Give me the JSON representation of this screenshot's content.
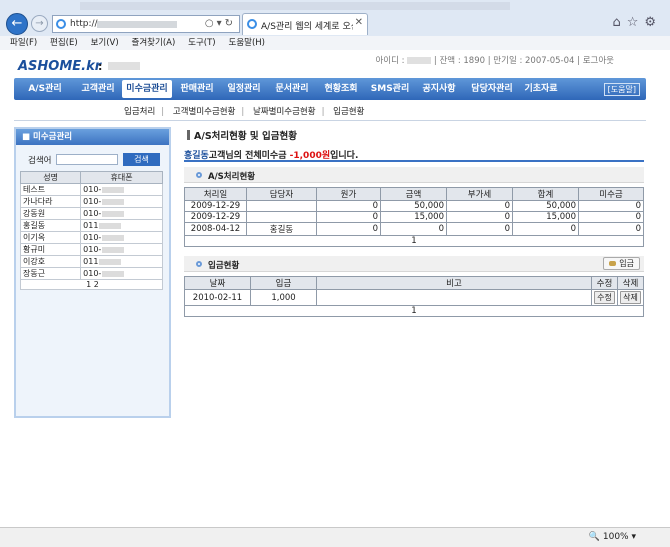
{
  "browser": {
    "url_prefix": "http://",
    "tab_title": "A/S관리 웹의 세계로 오신 ...",
    "menu": [
      "파일(F)",
      "편집(E)",
      "보기(V)",
      "즐겨찾기(A)",
      "도구(T)",
      "도움말(H)"
    ],
    "zoom": "100%"
  },
  "site": {
    "logo": "ASHOME.kr",
    "logo_sep": ":",
    "top_info": {
      "id_label": "아이디 :",
      "balance": "| 잔액 : 1890",
      "expiry": "| 만기일 : 2007-05-04",
      "logout": "| 로그아웃"
    }
  },
  "nav": {
    "items": [
      "A/S관리",
      "고객관리",
      "미수금관리",
      "판매관리",
      "일정관리",
      "문서관리",
      "현황조회",
      "SMS관리",
      "공지사항",
      "담당자관리",
      "기초자료"
    ],
    "active_index": 2,
    "help": "[도움말]"
  },
  "subnav": [
    "입금처리",
    "고객별미수금현황",
    "날짜별미수금현황",
    "입금현황"
  ],
  "left_panel": {
    "title": "미수금관리",
    "search_label": "검색어",
    "search_button": "검색",
    "columns": [
      "성명",
      "휴대폰"
    ],
    "rows": [
      [
        "테스트",
        "010-"
      ],
      [
        "가나다라",
        "010-"
      ],
      [
        "강동원",
        "010-"
      ],
      [
        "홍길동",
        "011"
      ],
      [
        "이기옥",
        "010-"
      ],
      [
        "황규미",
        "010-"
      ],
      [
        "이강호",
        "011"
      ],
      [
        "장동근",
        "010-"
      ]
    ],
    "pager": "1 2"
  },
  "main": {
    "title": "A/S처리현황 및 입금현황",
    "summary_name": "홍길동",
    "summary_text": "고객님의 전체미수금",
    "summary_amount": "-1,000원",
    "summary_tail": "입니다.",
    "as_section": {
      "title": "A/S처리현황",
      "columns": [
        "처리일",
        "담당자",
        "원가",
        "금액",
        "부가세",
        "합계",
        "미수금"
      ],
      "rows": [
        [
          "2009-12-29",
          "",
          "0",
          "50,000",
          "0",
          "50,000",
          "0"
        ],
        [
          "2009-12-29",
          "",
          "0",
          "15,000",
          "0",
          "15,000",
          "0"
        ],
        [
          "2008-04-12",
          "홍길동",
          "0",
          "0",
          "0",
          "0",
          "0"
        ]
      ],
      "pager": "1"
    },
    "deposit_section": {
      "title": "입금현황",
      "button": "입금",
      "columns": [
        "날짜",
        "입금",
        "비고",
        "수정",
        "삭제"
      ],
      "rows": [
        [
          "2010-02-11",
          "1,000",
          "",
          "수정",
          "삭제"
        ]
      ],
      "pager": "1"
    }
  }
}
